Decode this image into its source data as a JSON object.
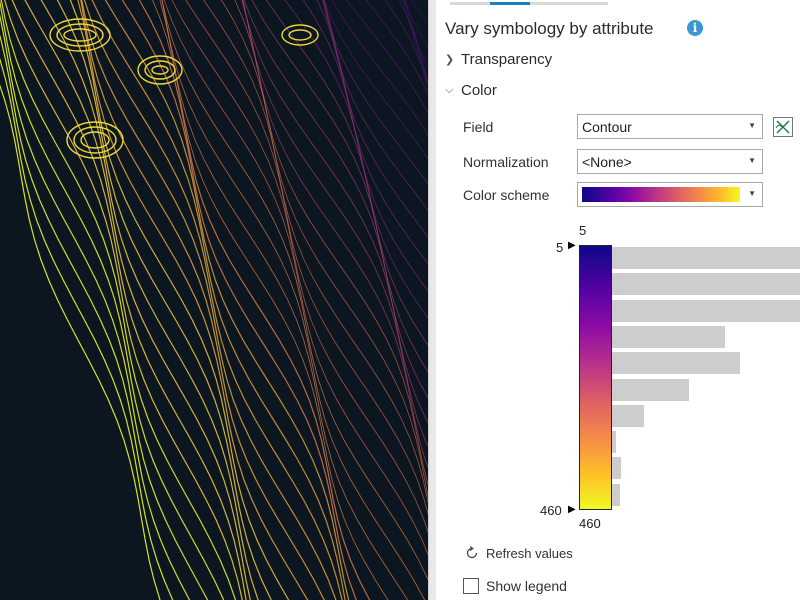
{
  "map": {
    "description": "contour map",
    "colors": [
      "#0b1620",
      "#f0f921",
      "#f48849",
      "#b83289",
      "#8b0aa5"
    ]
  },
  "panel": {
    "title": "Vary symbology by attribute",
    "info_icon": "info-icon",
    "sections": {
      "transparency": "Transparency",
      "color": "Color"
    },
    "field": {
      "label": "Field",
      "value": "Contour"
    },
    "normalization": {
      "label": "Normalization",
      "value": "<None>"
    },
    "color_scheme": {
      "label": "Color scheme",
      "colors": [
        "#0d0887",
        "#8b0aa5",
        "#db5c68",
        "#febd2a",
        "#f0f921"
      ]
    },
    "histogram": {
      "top_value": "5",
      "min_handle": "5",
      "max_handle": "460",
      "bottom_value": "460",
      "bar_values": [
        1.0,
        1.0,
        1.0,
        0.6,
        0.68,
        0.41,
        0.17,
        0.02,
        0.05,
        0.04
      ]
    },
    "refresh_label": "Refresh values",
    "show_legend": {
      "label": "Show legend",
      "checked": false
    }
  }
}
